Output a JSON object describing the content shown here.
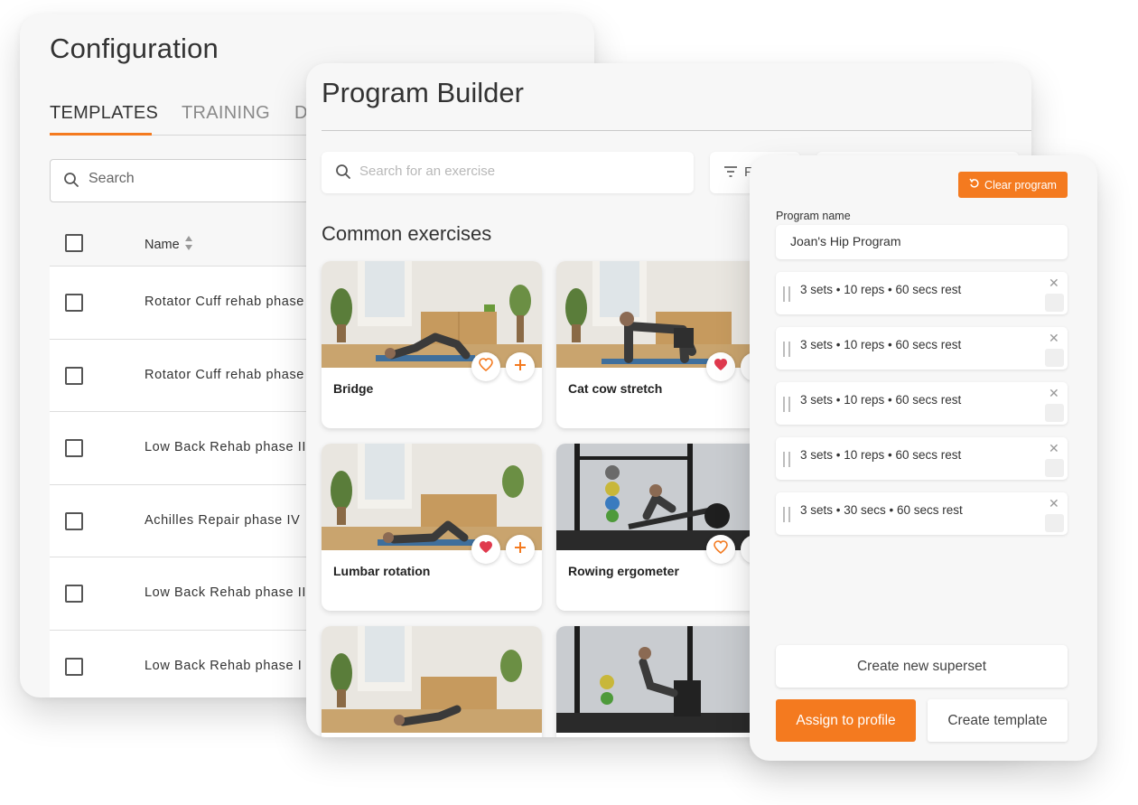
{
  "configuration": {
    "title": "Configuration",
    "tabs": [
      {
        "label": "TEMPLATES",
        "active": true
      },
      {
        "label": "TRAINING",
        "active": false
      },
      {
        "label": "D",
        "active": false
      }
    ],
    "search_placeholder": "Search",
    "table": {
      "name_header": "Name",
      "rows": [
        "Rotator Cuff rehab phase",
        "Rotator Cuff rehab phase",
        "Low Back Rehab phase III",
        "Achilles Repair phase IV",
        "Low Back Rehab phase II",
        "Low Back Rehab phase I"
      ]
    }
  },
  "builder": {
    "title": "Program Builder",
    "search_placeholder": "Search for an exercise",
    "filter_label": "F",
    "section_title": "Common exercises",
    "cards": [
      {
        "name": "Bridge",
        "favorited": false,
        "scene": "studio"
      },
      {
        "name": "Cat cow stretch",
        "favorited": true,
        "scene": "studio"
      },
      {
        "name": "Lumbar rotation",
        "favorited": true,
        "scene": "studio"
      },
      {
        "name": "Rowing ergometer",
        "favorited": false,
        "scene": "gym"
      },
      {
        "name": "",
        "favorited": false,
        "scene": "studio"
      },
      {
        "name": "",
        "favorited": false,
        "scene": "gym"
      }
    ]
  },
  "program": {
    "clear_label": "Clear program",
    "name_label": "Program name",
    "name_value": "Joan's Hip Program",
    "sets": [
      "3 sets • 10 reps • 60 secs rest",
      "3 sets • 10 reps • 60 secs rest",
      "3 sets • 10 reps • 60 secs rest",
      "3 sets • 10 reps • 60 secs rest",
      "3 sets • 30 secs • 60 secs rest"
    ],
    "create_superset_label": "Create new superset",
    "assign_label": "Assign to profile",
    "create_template_label": "Create template"
  },
  "colors": {
    "accent": "#f47a1f",
    "favorite": "#e03a4e",
    "panel_bg": "#f7f7f7"
  },
  "icons": [
    "search-icon",
    "sort-icon",
    "filter-icon",
    "heart-icon",
    "plus-icon",
    "undo-icon",
    "close-icon",
    "drag-handle-icon"
  ]
}
